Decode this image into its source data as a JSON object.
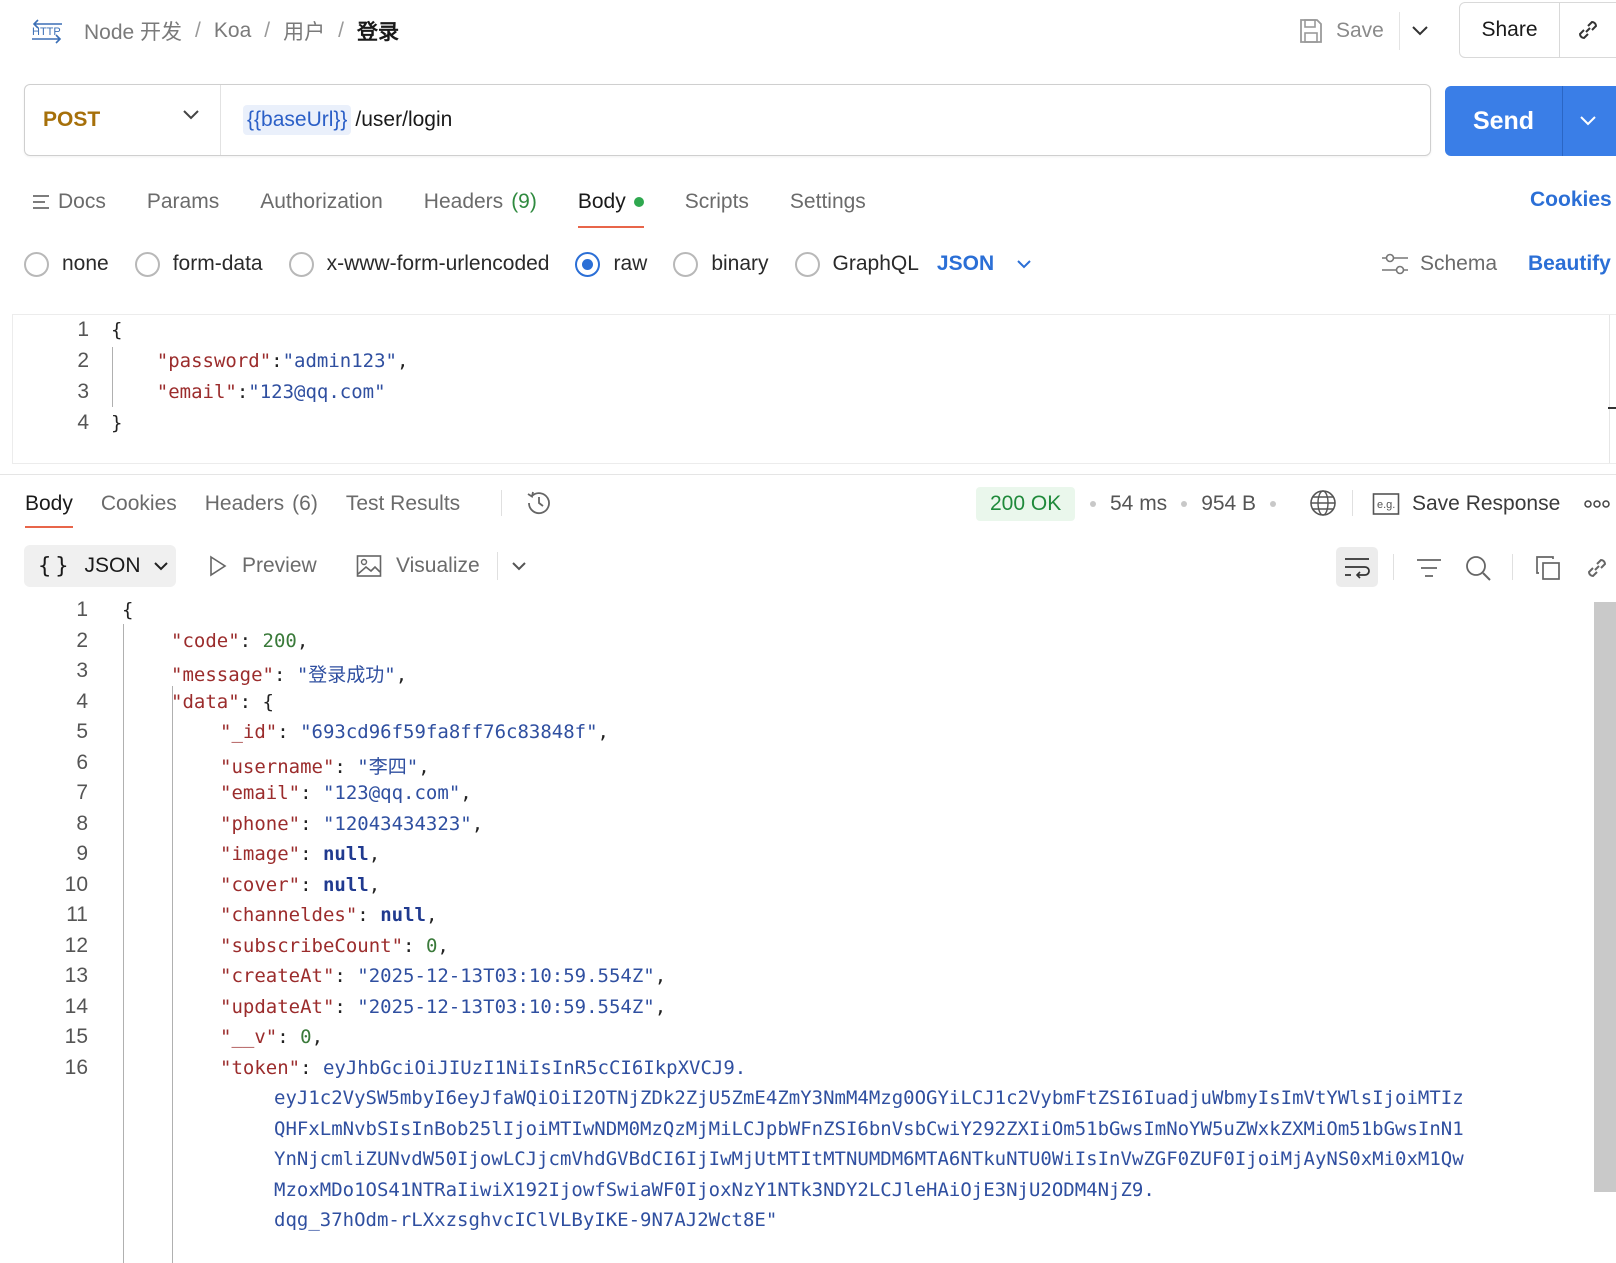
{
  "header": {
    "breadcrumb": [
      "Node 开发",
      "Koa",
      "用户",
      "登录"
    ],
    "save_label": "Save",
    "share_label": "Share",
    "logo_text": "HTTP"
  },
  "request": {
    "method": "POST",
    "url_variable": "{{baseUrl}}",
    "url_path": "/user/login",
    "send_label": "Send",
    "tabs": [
      {
        "label": "Docs"
      },
      {
        "label": "Params"
      },
      {
        "label": "Authorization"
      },
      {
        "label": "Headers",
        "count": "(9)"
      },
      {
        "label": "Body"
      },
      {
        "label": "Scripts"
      },
      {
        "label": "Settings"
      }
    ],
    "active_tab": "Body",
    "cookies_label": "Cookies",
    "body_types": [
      "none",
      "form-data",
      "x-www-form-urlencoded",
      "raw",
      "binary",
      "GraphQL"
    ],
    "selected_body_type": "raw",
    "raw_format": "JSON",
    "schema_label": "Schema",
    "beautify_label": "Beautify",
    "body_lines": [
      "{",
      "    \"password\":\"admin123\",",
      "    \"email\":\"123@qq.com\"",
      "}"
    ]
  },
  "response": {
    "tabs": [
      {
        "label": "Body"
      },
      {
        "label": "Cookies"
      },
      {
        "label": "Headers",
        "count": "(6)"
      },
      {
        "label": "Test Results"
      }
    ],
    "active_tab": "Body",
    "status": "200 OK",
    "time": "54 ms",
    "size": "954 B",
    "save_response_label": "Save Response",
    "format_label": "JSON",
    "preview_label": "Preview",
    "visualize_label": "Visualize",
    "body_lines": [
      {
        "n": "1",
        "text": "{"
      },
      {
        "n": "2",
        "text": "\"code\": 200,"
      },
      {
        "n": "3",
        "text": "\"message\": \"登录成功\","
      },
      {
        "n": "4",
        "text": "\"data\": {"
      },
      {
        "n": "5",
        "text": "\"_id\": \"693cd96f59fa8ff76c83848f\","
      },
      {
        "n": "6",
        "text": "\"username\": \"李四\","
      },
      {
        "n": "7",
        "text": "\"email\": \"123@qq.com\","
      },
      {
        "n": "8",
        "text": "\"phone\": \"12043434323\","
      },
      {
        "n": "9",
        "text": "\"image\": null,"
      },
      {
        "n": "10",
        "text": "\"cover\": null,"
      },
      {
        "n": "11",
        "text": "\"channeldes\": null,"
      },
      {
        "n": "12",
        "text": "\"subscribeCount\": 0,"
      },
      {
        "n": "13",
        "text": "\"createAt\": \"2025-12-13T03:10:59.554Z\","
      },
      {
        "n": "14",
        "text": "\"updateAt\": \"2025-12-13T03:10:59.554Z\","
      },
      {
        "n": "15",
        "text": "\"__v\": 0,"
      },
      {
        "n": "16",
        "text": "\"token\": \"eyJhbGciOiJIUzI1NiIsInR5cCI6IkpXVCJ9."
      }
    ],
    "token_continuation": [
      "eyJ1c2VySW5mbyI6eyJfaWQiOiI2OTNjZDk2ZjU5ZmE4ZmY3NmM4Mzg0OGYiLCJ1c2VybmFtZSI6IuadjuWbmyIsImVtYWlsIjoiMTIz",
      "QHFxLmNvbSIsInBob25lIjoiMTIwNDM0MzQzMjMiLCJpbWFnZSI6bnVsbCwiY292ZXIiOm51bGwsImNoYW5uZWxkZXMiOm51bGwsInN1",
      "YnNjcmliZUNvdW50IjowLCJjcmVhdGVBdCI6IjIwMjUtMTItMTNUMDM6MTA6NTkuNTU0WiIsInVwZGF0ZUF0IjoiMjAyNS0xMi0xM1Qw",
      "MzoxMDo1OS41NTRaIiwiX192IjowfSwiaWF0IjoxNzY1NTk3NDY2LCJleHAiOjE3NjU2ODM4NjZ9.",
      "dqg_37hOdm-rLXxzsghvcIClVLByIKE-9N7AJ2Wct8E\""
    ]
  },
  "colors": {
    "accent": "#3a7ee7",
    "method": "#a6700a",
    "status_ok": "#1f8a3b",
    "tab_underline": "#e8654a"
  }
}
